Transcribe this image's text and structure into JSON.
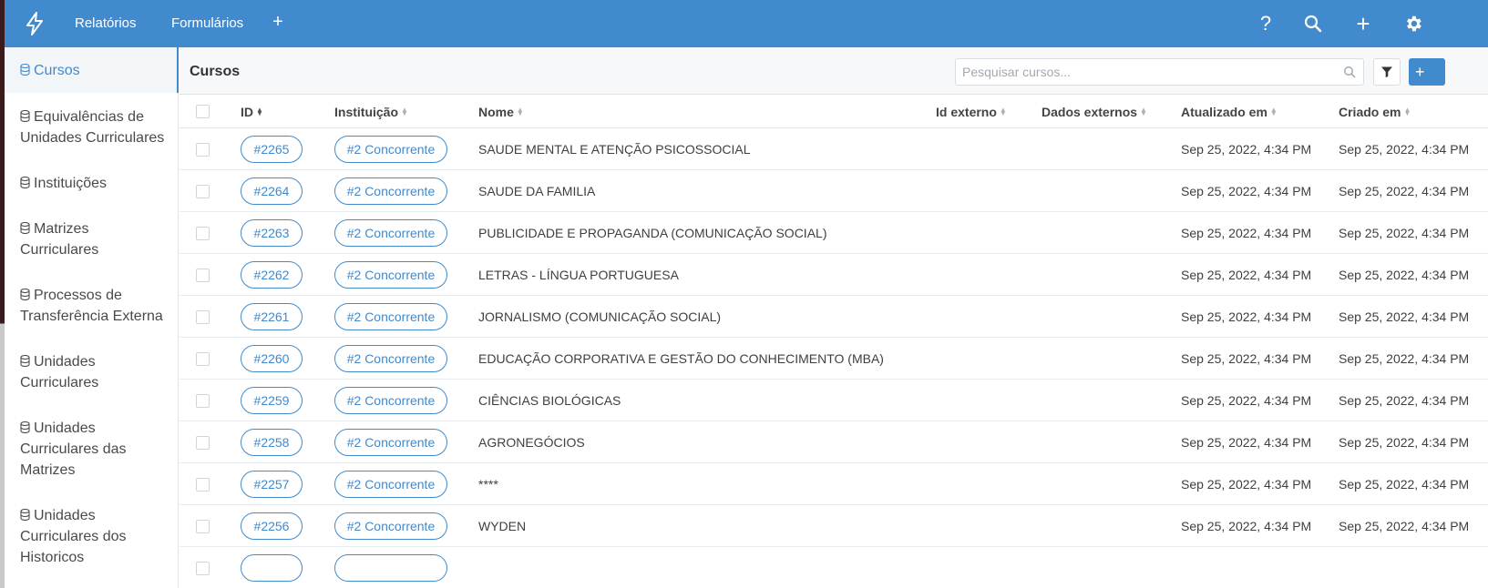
{
  "topbar": {
    "nav": [
      {
        "label": "Relatórios"
      },
      {
        "label": "Formulários"
      }
    ],
    "add_symbol": "+",
    "right_icons": [
      "help-icon",
      "search-icon",
      "plus-icon",
      "gear-icon"
    ],
    "help_symbol": "?",
    "plus_symbol": "+"
  },
  "sidebar": {
    "items": [
      {
        "label": "Cursos",
        "active": true
      },
      {
        "label": "Equivalências de Unidades Curriculares"
      },
      {
        "label": "Instituições"
      },
      {
        "label": "Matrizes Curriculares"
      },
      {
        "label": "Processos de Transferência Externa"
      },
      {
        "label": "Unidades Curriculares"
      },
      {
        "label": "Unidades Curriculares das Matrizes"
      },
      {
        "label": "Unidades Curriculares dos Historicos"
      }
    ]
  },
  "main": {
    "title": "Cursos",
    "search_placeholder": "Pesquisar cursos...",
    "add_label": "+",
    "columns": [
      "ID",
      "Instituição",
      "Nome",
      "Id externo",
      "Dados externos",
      "Atualizado em",
      "Criado em"
    ],
    "rows": [
      {
        "id": "#2265",
        "inst": "#2 Concorrente",
        "nome": "SAUDE MENTAL E ATENÇÃO PSICOSSOCIAL",
        "upd": "Sep 25, 2022, 4:34 PM",
        "cre": "Sep 25, 2022, 4:34 PM"
      },
      {
        "id": "#2264",
        "inst": "#2 Concorrente",
        "nome": "SAUDE DA FAMILIA",
        "upd": "Sep 25, 2022, 4:34 PM",
        "cre": "Sep 25, 2022, 4:34 PM"
      },
      {
        "id": "#2263",
        "inst": "#2 Concorrente",
        "nome": "PUBLICIDADE E PROPAGANDA (COMUNICAÇÃO SOCIAL)",
        "upd": "Sep 25, 2022, 4:34 PM",
        "cre": "Sep 25, 2022, 4:34 PM"
      },
      {
        "id": "#2262",
        "inst": "#2 Concorrente",
        "nome": "LETRAS - LÍNGUA PORTUGUESA",
        "upd": "Sep 25, 2022, 4:34 PM",
        "cre": "Sep 25, 2022, 4:34 PM"
      },
      {
        "id": "#2261",
        "inst": "#2 Concorrente",
        "nome": "JORNALISMO (COMUNICAÇÃO SOCIAL)",
        "upd": "Sep 25, 2022, 4:34 PM",
        "cre": "Sep 25, 2022, 4:34 PM"
      },
      {
        "id": "#2260",
        "inst": "#2 Concorrente",
        "nome": "EDUCAÇÃO CORPORATIVA E GESTÃO DO CONHECIMENTO (MBA)",
        "upd": "Sep 25, 2022, 4:34 PM",
        "cre": "Sep 25, 2022, 4:34 PM"
      },
      {
        "id": "#2259",
        "inst": "#2 Concorrente",
        "nome": "CIÊNCIAS BIOLÓGICAS",
        "upd": "Sep 25, 2022, 4:34 PM",
        "cre": "Sep 25, 2022, 4:34 PM"
      },
      {
        "id": "#2258",
        "inst": "#2 Concorrente",
        "nome": "AGRONEGÓCIOS",
        "upd": "Sep 25, 2022, 4:34 PM",
        "cre": "Sep 25, 2022, 4:34 PM"
      },
      {
        "id": "#2257",
        "inst": "#2 Concorrente",
        "nome": "****",
        "upd": "Sep 25, 2022, 4:34 PM",
        "cre": "Sep 25, 2022, 4:34 PM"
      },
      {
        "id": "#2256",
        "inst": "#2 Concorrente",
        "nome": "WYDEN",
        "upd": "Sep 25, 2022, 4:34 PM",
        "cre": "Sep 25, 2022, 4:34 PM"
      }
    ]
  },
  "colors": {
    "brand": "#418acd",
    "border": "#dfe4ea",
    "text": "#3f3f3f"
  }
}
